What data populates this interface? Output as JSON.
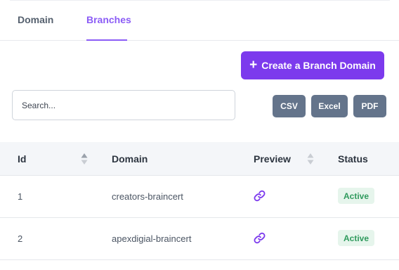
{
  "tabs": [
    {
      "label": "Domain",
      "active": false
    },
    {
      "label": "Branches",
      "active": true
    }
  ],
  "colors": {
    "accent": "#7c3aed",
    "tab_active": "#8b5cf6",
    "export_button": "#64748b",
    "status_active_bg": "#e6f5ec",
    "status_active_text": "#2f9a5d"
  },
  "toolbar": {
    "create_label": "Create a Branch Domain",
    "create_icon": "plus-icon",
    "search_placeholder": "Search...",
    "search_value": "",
    "export_buttons": [
      "CSV",
      "Excel",
      "PDF"
    ]
  },
  "table": {
    "columns": [
      "Id",
      "Domain",
      "Preview",
      "Status"
    ],
    "sortable_columns": [
      "Id",
      "Preview"
    ],
    "preview_icon": "link-icon",
    "rows": [
      {
        "id": "1",
        "domain": "creators-braincert",
        "status": "Active"
      },
      {
        "id": "2",
        "domain": "apexdigial-braincert",
        "status": "Active"
      }
    ]
  }
}
